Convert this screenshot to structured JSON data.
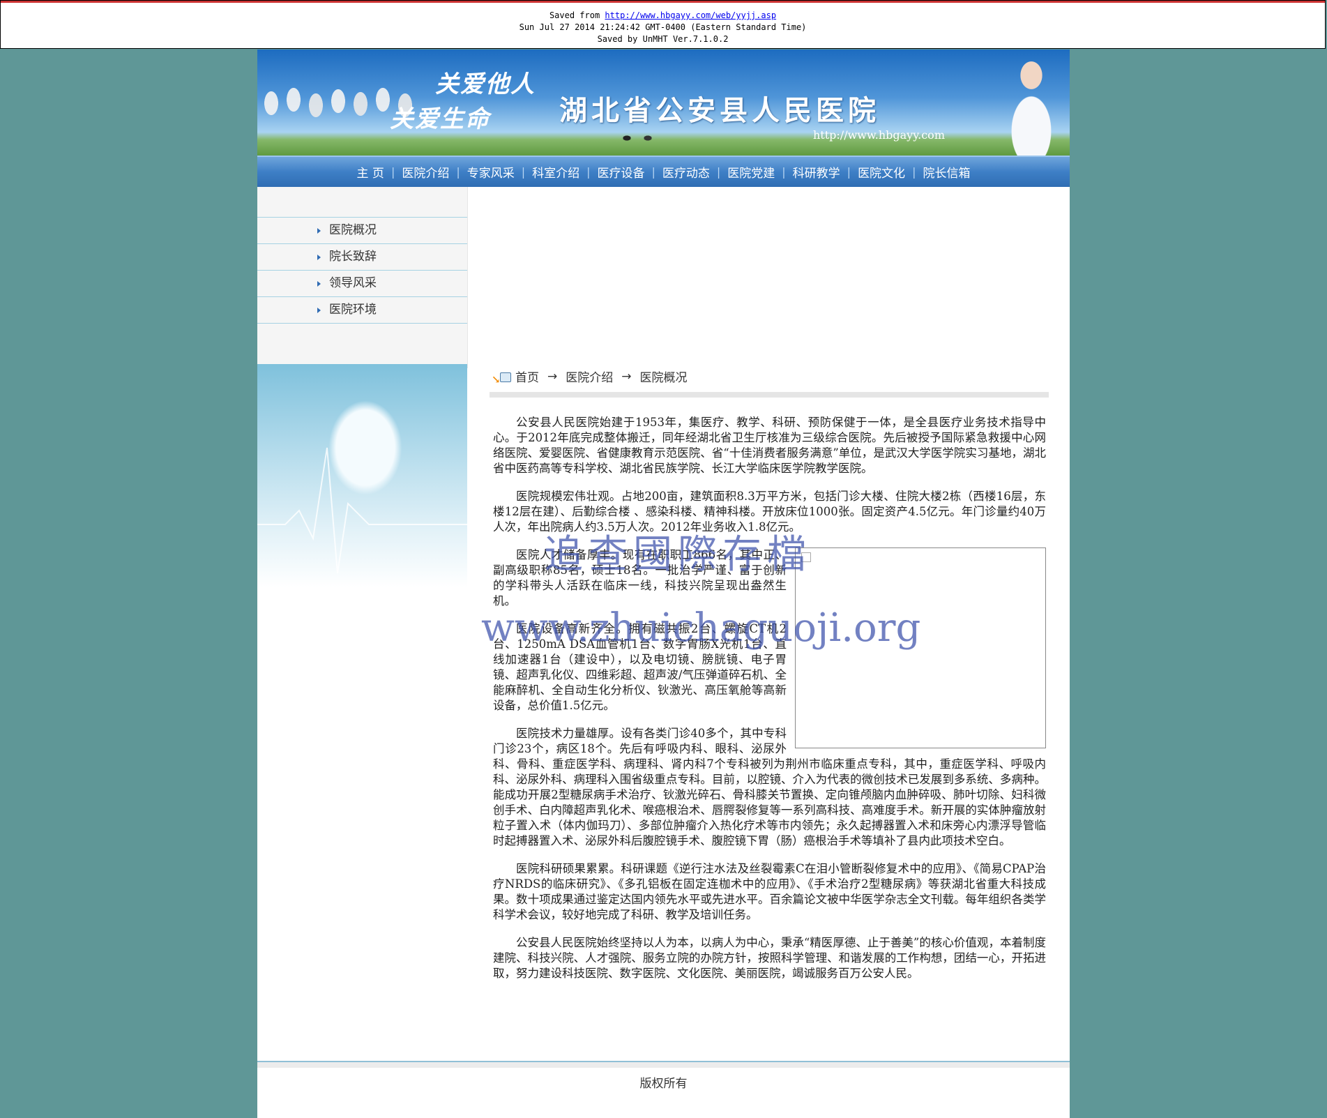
{
  "saved_banner": {
    "saved_from_prefix": "Saved from ",
    "saved_from_url": "http://www.hbgayy.com/web/yyjj.asp",
    "date_line": "Sun Jul 27 2014 21:24:42 GMT-0400 (Eastern Standard Time)",
    "saved_by": "Saved by UnMHT Ver.7.1.0.2"
  },
  "header": {
    "slogan_top": "关爱他人",
    "slogan_bottom": "关爱生命",
    "hospital_name": "湖北省公安县人民医院",
    "site_url": "http://www.hbgayy.com"
  },
  "nav": {
    "items": [
      "主 页",
      "医院介绍",
      "专家风采",
      "科室介绍",
      "医疗设备",
      "医疗动态",
      "医院党建",
      "科研教学",
      "医院文化",
      "院长信箱"
    ]
  },
  "sidebar": {
    "items": [
      "医院概况",
      "院长致辞",
      "领导风采",
      "医院环境"
    ]
  },
  "breadcrumb": {
    "home": "首页",
    "section": "医院介绍",
    "current": "医院概况",
    "arrow": "→"
  },
  "article": {
    "paragraphs": [
      "公安县人民医院始建于1953年，集医疗、教学、科研、预防保健于一体，是全县医疗业务技术指导中心。于2012年底完成整体搬迁，同年经湖北省卫生厅核准为三级综合医院。先后被授予国际紧急救援中心网络医院、爱婴医院、省健康教育示范医院、省“十佳消费者服务满意”单位，是武汉大学医学院实习基地，湖北省中医药高等专科学校、湖北省民族学院、长江大学临床医学院教学医院。",
      "医院规模宏伟壮观。占地200亩，建筑面积8.3万平方米，包括门诊大楼、住院大楼2栋（西楼16层，东楼12层在建）、后勤综合楼 、感染科楼、精神科楼。开放床位1000张。固定资产4.5亿元。年门诊量约40万人次，年出院病人约3.5万人次。2012年业务收入1.8亿元。",
      "医院人才储备厚丰。现有在职职工866名，其中正、副高级职称85名，硕士18名。一批治学严谨、富于创新的学科带头人活跃在临床一线，科技兴院呈现出盎然生机。",
      "医院设备高新齐全。拥有磁共振2台、螺旋CT机2台、1250mA DSA血管机1台、数字胃肠X光机1台、直线加速器1台（建设中），以及电切镜、膀胱镜、电子胃镜、超声乳化仪、四维彩超、超声波/气压弹道碎石机、全能麻醉机、全自动生化分析仪、钬激光、高压氧舱等高新设备，总价值1.5亿元。",
      "医院技术力量雄厚。设有各类门诊40多个，其中专科门诊23个，病区18个。先后有呼吸内科、眼科、泌尿外科、骨科、重症医学科、病理科、肾内科7个专科被列为荆州市临床重点专科，其中，重症医学科、呼吸内科、泌尿外科、病理科入围省级重点专科。目前，以腔镜、介入为代表的微创技术已发展到多系统、多病种。能成功开展2型糖尿病手术治疗、钬激光碎石、骨科膝关节置换、定向锥颅脑内血肿碎吸、肺叶切除、妇科微创手术、白内障超声乳化术、喉癌根治术、唇腭裂修复等一系列高科技、高难度手术。新开展的实体肿瘤放射粒子置入术（体内伽玛刀）、多部位肿瘤介入热化疗术等市内领先；永久起搏器置入术和床旁心内漂浮导管临时起搏器置入术、泌尿外科后腹腔镜手术、腹腔镜下胃（肠）癌根治手术等填补了县内此项技术空白。",
      "医院科研硕果累累。科研课题《逆行注水法及丝裂霉素C在泪小管断裂修复术中的应用》、《简易CPAP治疗NRDS的临床研究》、《多孔铝板在固定连枷术中的应用》、《手术治疗2型糖尿病》等获湖北省重大科技成果。数十项成果通过鉴定达国内领先水平或先进水平。百余篇论文被中华医学杂志全文刊载。每年组织各类学科学术会议，较好地完成了科研、教学及培训任务。",
      "公安县人民医院始终坚持以人为本，以病人为中心，秉承“精医厚德、止于善美”的核心价值观，本着制度建院、科技兴院、人才强院、服务立院的办院方针，按照科学管理、和谐发展的工作构想，团结一心，开拓进取，努力建设科技医院、数字医院、文化医院、美丽医院，竭诚服务百万公安人民。"
    ]
  },
  "watermark": {
    "line1": "追查國際存檔",
    "line2": "www.zhuichaguoji.org"
  },
  "footer": {
    "copyright": "版权所有"
  }
}
